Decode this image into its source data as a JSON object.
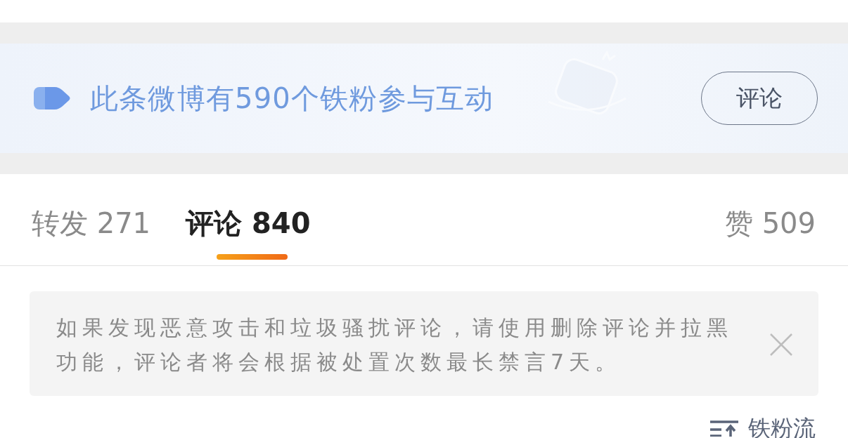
{
  "banner": {
    "text": "此条微博有590个铁粉参与互动",
    "button": "评论"
  },
  "tabs": [
    {
      "label": "转发",
      "count": "271",
      "selected": false
    },
    {
      "label": "评论",
      "count": "840",
      "selected": true
    },
    {
      "label": "赞",
      "count": "509",
      "selected": false
    }
  ],
  "notice": {
    "text": "如果发现恶意攻击和垃圾骚扰评论，请使用删除评论并拉黑功能，评论者将会根据被处置次数最长禁言7天。"
  },
  "sort": {
    "label": "铁粉流"
  }
}
